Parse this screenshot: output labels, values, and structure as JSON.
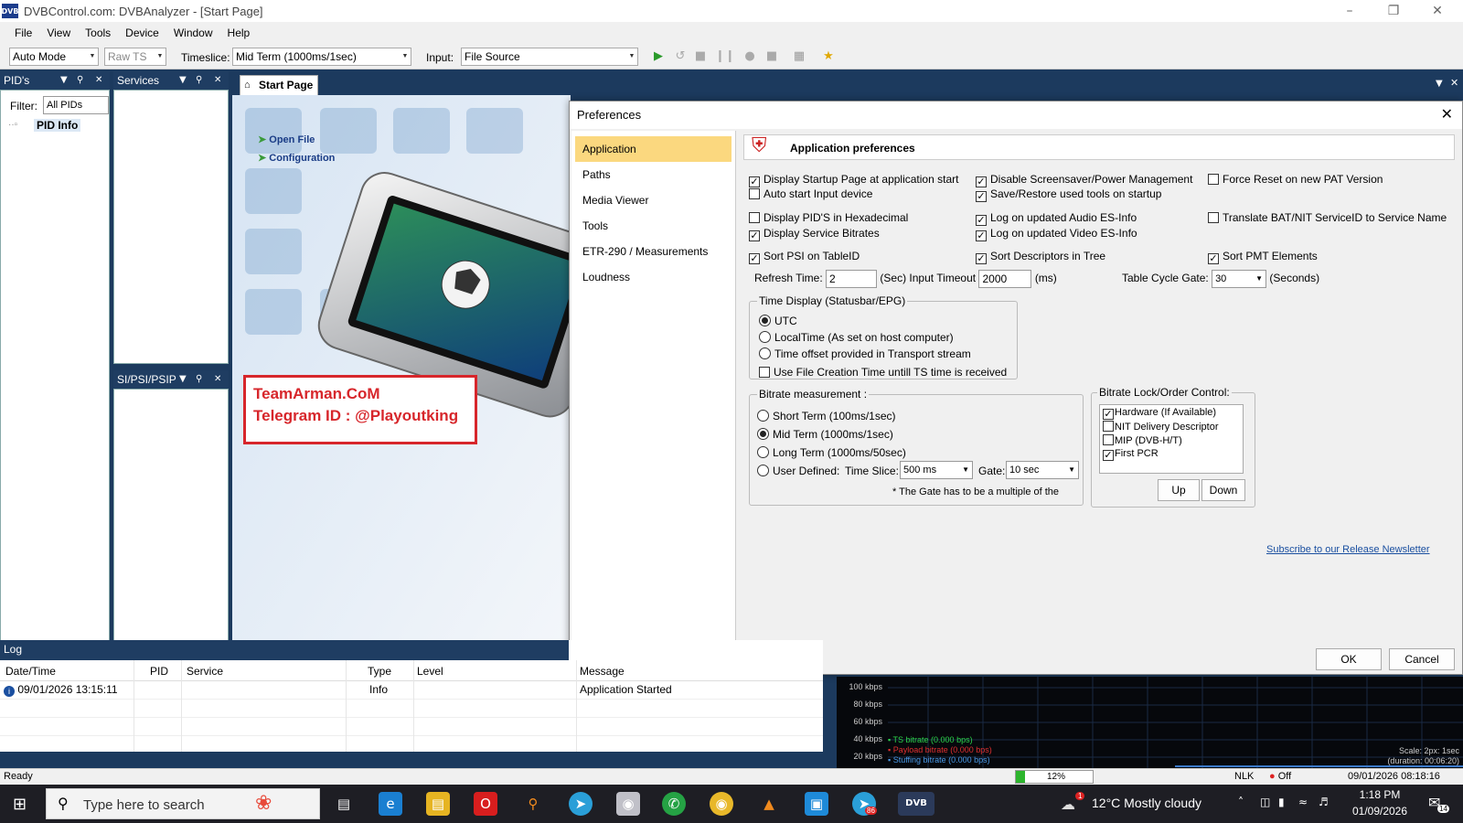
{
  "window": {
    "title": "DVBControl.com: DVBAnalyzer - [Start Page]",
    "logo_text": "DVB"
  },
  "menu": [
    "File",
    "View",
    "Tools",
    "Device",
    "Window",
    "Help"
  ],
  "toolbar": {
    "mode": "Auto Mode",
    "ts_type": "Raw TS",
    "timeslice_label": "Timeslice:",
    "timeslice_value": "Mid Term (1000ms/1sec)",
    "input_label": "Input:",
    "input_value": "File Source"
  },
  "pids_panel": {
    "title": "PID's",
    "filter_label": "Filter:",
    "filter_value": "All PIDs",
    "tree_item": "PID Info"
  },
  "services_panel": {
    "title": "Services"
  },
  "sipsi_panel": {
    "title": "SI/PSI/PSIP"
  },
  "start_page": {
    "tab_label": "Start Page",
    "links": [
      "Open File",
      "Configuration"
    ],
    "watermark_line1": "TeamArman.CoM",
    "watermark_line2": "Telegram ID : @Playoutking"
  },
  "preferences": {
    "title": "Preferences",
    "nav": [
      "Application",
      "Paths",
      "Media Viewer",
      "Tools",
      "ETR-290 / Measurements",
      "Loudness"
    ],
    "header": "Application preferences",
    "checkboxes": {
      "display_startup": {
        "label": "Display Startup Page at application start",
        "checked": true
      },
      "disable_screensaver": {
        "label": "Disable Screensaver/Power Management",
        "checked": true
      },
      "force_reset": {
        "label": "Force Reset on new PAT Version",
        "checked": false
      },
      "auto_start": {
        "label": "Auto start Input device",
        "checked": false
      },
      "save_restore": {
        "label": "Save/Restore used tools on startup",
        "checked": true
      },
      "pid_hex": {
        "label": "Display PID'S in Hexadecimal",
        "checked": false
      },
      "log_audio": {
        "label": "Log on updated Audio ES-Info",
        "checked": true
      },
      "translate_bat": {
        "label": "Translate BAT/NIT ServiceID to Service Name",
        "checked": false
      },
      "service_bitrates": {
        "label": "Display Service Bitrates",
        "checked": true
      },
      "log_video": {
        "label": "Log on updated Video ES-Info",
        "checked": true
      },
      "sort_psi": {
        "label": "Sort PSI on TableID",
        "checked": true
      },
      "sort_desc": {
        "label": "Sort Descriptors in Tree",
        "checked": true
      },
      "sort_pmt": {
        "label": "Sort PMT Elements",
        "checked": true
      }
    },
    "refresh_label": "Refresh Time:",
    "refresh_value": "2",
    "sec_label": "(Sec)",
    "timeout_label": "Input Timeout",
    "timeout_value": "2000",
    "ms_label": "(ms)",
    "cycle_label": "Table Cycle Gate:",
    "cycle_value": "30",
    "seconds_label": "(Seconds)",
    "time_display": {
      "title": "Time Display (Statusbar/EPG)",
      "options": [
        "UTC",
        "LocalTime (As set on host computer)",
        "Time offset provided in Transport stream"
      ],
      "selected": "UTC",
      "file_creation": "Use File Creation Time untill TS time is received"
    },
    "bitrate": {
      "title": "Bitrate measurement :",
      "options": [
        "Short Term (100ms/1sec)",
        "Mid Term (1000ms/1sec)",
        "Long Term (1000ms/50sec)",
        "User Defined:"
      ],
      "selected": "Mid Term (1000ms/1sec)",
      "slice_label": "Time Slice:",
      "slice_value": "500 ms",
      "gate_label": "Gate:",
      "gate_value": "10 sec",
      "note": "* The Gate has to be a multiple of the"
    },
    "lock": {
      "title": "Bitrate Lock/Order Control:",
      "items": [
        {
          "label": "Hardware (If Available)",
          "checked": true
        },
        {
          "label": "NIT Delivery Descriptor",
          "checked": false
        },
        {
          "label": "MIP (DVB-H/T)",
          "checked": false
        },
        {
          "label": "First PCR",
          "checked": true
        }
      ],
      "up": "Up",
      "down": "Down"
    },
    "newsletter": "Subscribe to our Release Newsletter",
    "ok": "OK",
    "cancel": "Cancel"
  },
  "log": {
    "title": "Log",
    "columns": [
      "Date/Time",
      "PID",
      "Service",
      "Type",
      "Level",
      "Message"
    ],
    "rows": [
      {
        "datetime": "09/01/2026 13:15:11",
        "pid": "",
        "service": "",
        "type": "Info",
        "level": "",
        "message": "Application Started"
      }
    ]
  },
  "graph": {
    "ylabels": [
      "100 kbps",
      "80 kbps",
      "60 kbps",
      "40 kbps",
      "20 kbps"
    ],
    "legend": [
      "TS bitrate (0.000 bps)",
      "Payload bitrate (0.000 bps)",
      "Stuffing bitrate (0.000 bps)"
    ],
    "scale": "Scale: 2px: 1sec",
    "duration": "(duration: 00:06:20)"
  },
  "status": {
    "text": "Ready",
    "progress": "12%",
    "nlk": "NLK",
    "off": "Off",
    "datetime": "09/01/2026 08:18:16"
  },
  "taskbar": {
    "search": "Type here to search",
    "weather": "12°C  Mostly cloudy",
    "time": "1:18 PM",
    "date": "01/09/2026",
    "weather_badge": "1",
    "notif": "14",
    "tg_badge": "86"
  },
  "colors": {
    "accent": "#1f3d62",
    "nav_selected": "#fbd87f",
    "watermark": "#d7262b",
    "link": "#1a4fa0"
  }
}
